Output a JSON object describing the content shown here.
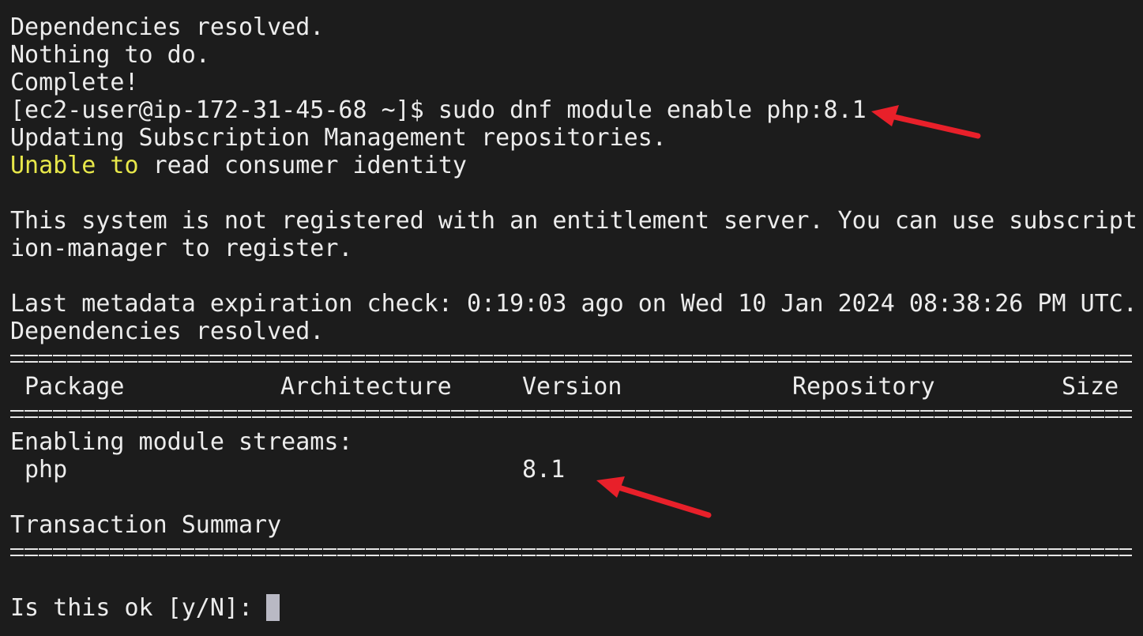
{
  "terminal": {
    "lines": {
      "l1": "Dependencies resolved.",
      "l2": "Nothing to do.",
      "l3": "Complete!",
      "prompt": "[ec2-user@ip-172-31-45-68 ~]$ sudo dnf module enable php:8.1",
      "l5": "Updating Subscription Management repositories.",
      "l6_warn": "Unable to",
      "l6_rest": " read consumer identity",
      "l8": "This system is not registered with an entitlement server. You can use subscript",
      "l9": "ion-manager to register.",
      "l11": "Last metadata expiration check: 0:19:03 ago on Wed 10 Jan 2024 08:38:26 PM UTC.",
      "l12": "Dependencies resolved.",
      "streams_heading": "Enabling module streams:",
      "summary": "Transaction Summary",
      "confirm_prompt": "Is this ok [y/N]: "
    },
    "table": {
      "headers": {
        "package": "Package",
        "architecture": "Architecture",
        "version": "Version",
        "repository": "Repository",
        "size": "Size"
      },
      "rows": [
        {
          "package": "php",
          "version": "8.1"
        }
      ]
    },
    "colors": {
      "background": "#1c1c1c",
      "text": "#ececec",
      "warning": "#e8e84a",
      "arrow": "#e8202a",
      "cursor": "#b9b9c4"
    }
  }
}
